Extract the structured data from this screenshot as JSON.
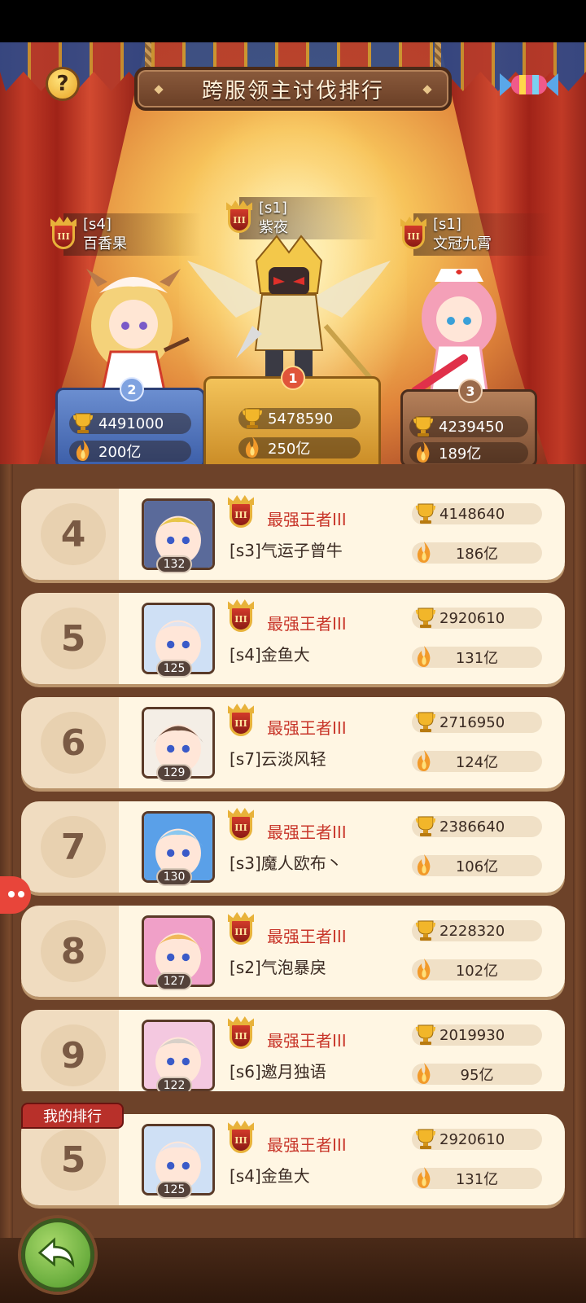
{
  "title": "跨服领主讨伐排行",
  "podium": [
    {
      "place": "2",
      "server": "[s4]",
      "name": "百香果",
      "emblem": "III",
      "score": "4491000",
      "power": "200亿"
    },
    {
      "place": "1",
      "server": "[s1]",
      "name": "紫夜",
      "emblem": "III",
      "score": "5478590",
      "power": "250亿"
    },
    {
      "place": "3",
      "server": "[s1]",
      "name": "文冠九霄",
      "emblem": "III",
      "score": "4239450",
      "power": "189亿"
    }
  ],
  "list": [
    {
      "rank": "4",
      "level": "132",
      "emblem": "III",
      "title": "最强王者III",
      "name": "[s3]气运子曾牛",
      "score": "4148640",
      "power": "186亿"
    },
    {
      "rank": "5",
      "level": "125",
      "emblem": "III",
      "title": "最强王者III",
      "name": "[s4]金鱼大",
      "score": "2920610",
      "power": "131亿"
    },
    {
      "rank": "6",
      "level": "129",
      "emblem": "III",
      "title": "最强王者III",
      "name": "[s7]云淡风轻",
      "score": "2716950",
      "power": "124亿"
    },
    {
      "rank": "7",
      "level": "130",
      "emblem": "III",
      "title": "最强王者III",
      "name": "[s3]魔人欧布丶",
      "score": "2386640",
      "power": "106亿"
    },
    {
      "rank": "8",
      "level": "127",
      "emblem": "III",
      "title": "最强王者III",
      "name": "[s2]气泡暴戾",
      "score": "2228320",
      "power": "102亿"
    },
    {
      "rank": "9",
      "level": "122",
      "emblem": "III",
      "title": "最强王者III",
      "name": "[s6]邀月独语",
      "score": "2019930",
      "power": "95亿"
    }
  ],
  "my_rank_label": "我的排行",
  "my_rank": {
    "rank": "5",
    "level": "125",
    "emblem": "III",
    "title": "最强王者III",
    "name": "[s4]金鱼大",
    "score": "2920610",
    "power": "131亿"
  },
  "help_label": "?",
  "colors": {
    "title_red": "#c8362a",
    "accent_gold": "#e8b23a"
  },
  "icons": {
    "score": "trophy-icon",
    "power": "flame-icon",
    "back": "back-arrow-icon",
    "help": "help-icon"
  }
}
